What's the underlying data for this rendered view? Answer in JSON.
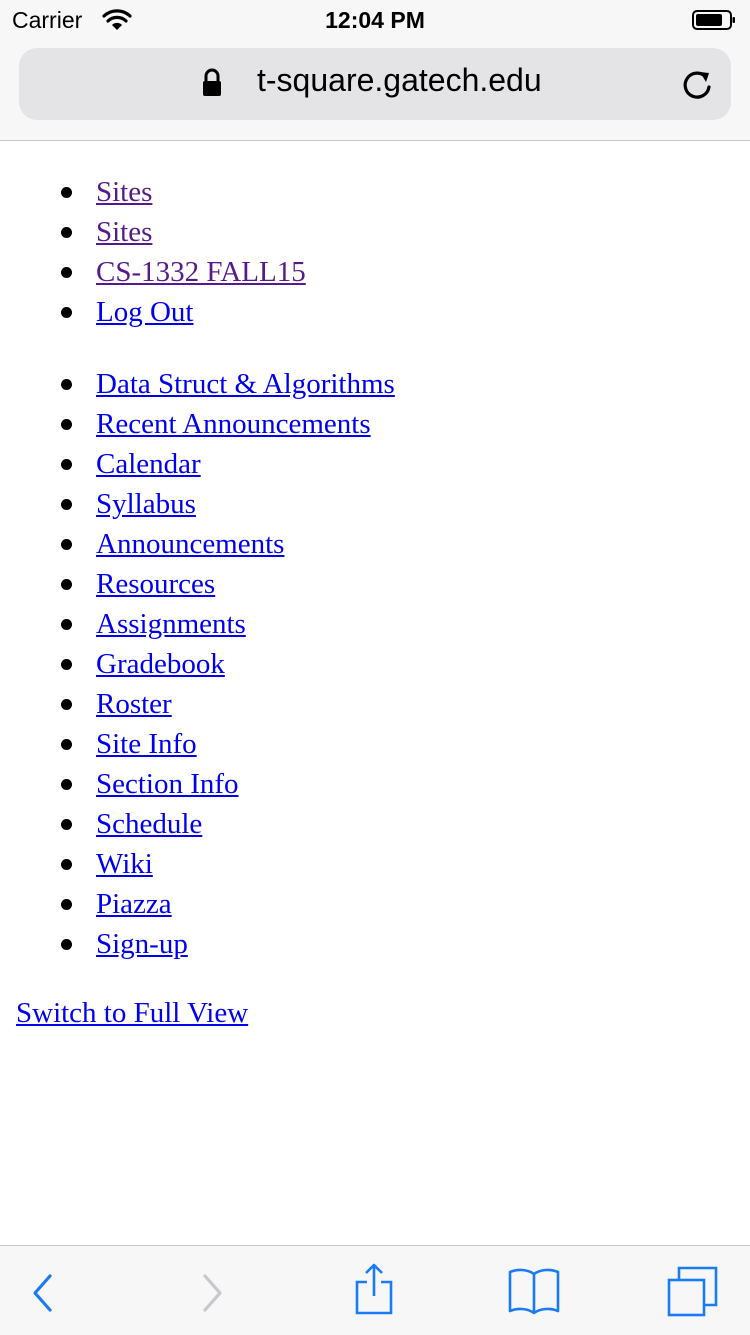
{
  "status_bar": {
    "carrier": "Carrier",
    "time": "12:04 PM",
    "wifi_icon": "wifi-icon",
    "battery_icon": "battery-icon"
  },
  "address_bar": {
    "url": "t-square.gatech.edu",
    "lock_icon": "lock-icon",
    "reload_icon": "reload-icon"
  },
  "top_links": [
    {
      "label": "Sites",
      "visited": true
    },
    {
      "label": "Sites",
      "visited": true
    },
    {
      "label": "CS-1332 FALL15",
      "visited": true
    },
    {
      "label": "Log Out",
      "visited": false
    }
  ],
  "tool_links": [
    {
      "label": "Data Struct & Algorithms"
    },
    {
      "label": "Recent Announcements"
    },
    {
      "label": "Calendar"
    },
    {
      "label": "Syllabus"
    },
    {
      "label": "Announcements"
    },
    {
      "label": "Resources"
    },
    {
      "label": "Assignments"
    },
    {
      "label": "Gradebook"
    },
    {
      "label": "Roster"
    },
    {
      "label": "Site Info"
    },
    {
      "label": "Section Info"
    },
    {
      "label": "Schedule"
    },
    {
      "label": "Wiki"
    },
    {
      "label": "Piazza"
    },
    {
      "label": "Sign-up"
    }
  ],
  "footer": {
    "full_view_link": "Switch to Full View"
  },
  "toolbar": {
    "back_icon": "back-icon",
    "forward_icon": "forward-icon",
    "share_icon": "share-icon",
    "bookmarks_icon": "bookmarks-icon",
    "tabs_icon": "tabs-icon"
  },
  "colors": {
    "link": "#0000ee",
    "visited_link": "#551a8b",
    "ios_blue": "#1a7cf5",
    "disabled": "#c7c7cc"
  }
}
